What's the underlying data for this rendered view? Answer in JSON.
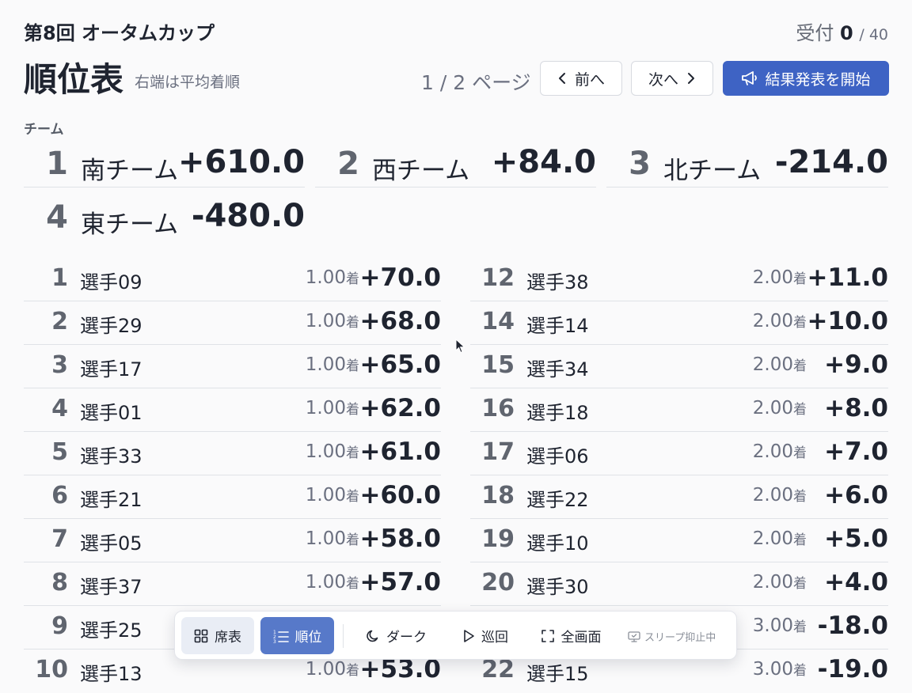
{
  "header": {
    "event_title": "第8回 オータムカップ",
    "reception_label": "受付",
    "reception_count": "0",
    "reception_total": "/ 40"
  },
  "title": "順位表",
  "subtitle": "右端は平均着順",
  "pager": {
    "indicator": "1 / 2 ページ",
    "prev_label": "前へ",
    "next_label": "次へ",
    "announce_label": "結果発表を開始"
  },
  "teams_label": "チーム",
  "teams": [
    {
      "rank": "1",
      "name": "南チーム",
      "score": "+610.0"
    },
    {
      "rank": "2",
      "name": "西チーム",
      "score": "+84.0"
    },
    {
      "rank": "3",
      "name": "北チーム",
      "score": "-214.0"
    },
    {
      "rank": "4",
      "name": "東チーム",
      "score": "-480.0"
    }
  ],
  "avg_unit": "着",
  "players_left": [
    {
      "rank": "1",
      "name": "選手09",
      "avg": "1.00",
      "score": "+70.0"
    },
    {
      "rank": "2",
      "name": "選手29",
      "avg": "1.00",
      "score": "+68.0"
    },
    {
      "rank": "3",
      "name": "選手17",
      "avg": "1.00",
      "score": "+65.0"
    },
    {
      "rank": "4",
      "name": "選手01",
      "avg": "1.00",
      "score": "+62.0"
    },
    {
      "rank": "5",
      "name": "選手33",
      "avg": "1.00",
      "score": "+61.0"
    },
    {
      "rank": "6",
      "name": "選手21",
      "avg": "1.00",
      "score": "+60.0"
    },
    {
      "rank": "7",
      "name": "選手05",
      "avg": "1.00",
      "score": "+58.0"
    },
    {
      "rank": "8",
      "name": "選手37",
      "avg": "1.00",
      "score": "+57.0"
    },
    {
      "rank": "9",
      "name": "選手25",
      "avg": "",
      "score": ""
    },
    {
      "rank": "10",
      "name": "選手13",
      "avg": "1.00",
      "score": "+53.0"
    }
  ],
  "players_right": [
    {
      "rank": "12",
      "name": "選手38",
      "avg": "2.00",
      "score": "+11.0"
    },
    {
      "rank": "14",
      "name": "選手14",
      "avg": "2.00",
      "score": "+10.0"
    },
    {
      "rank": "15",
      "name": "選手34",
      "avg": "2.00",
      "score": "+9.0"
    },
    {
      "rank": "16",
      "name": "選手18",
      "avg": "2.00",
      "score": "+8.0"
    },
    {
      "rank": "17",
      "name": "選手06",
      "avg": "2.00",
      "score": "+7.0"
    },
    {
      "rank": "18",
      "name": "選手22",
      "avg": "2.00",
      "score": "+6.0"
    },
    {
      "rank": "19",
      "name": "選手10",
      "avg": "2.00",
      "score": "+5.0"
    },
    {
      "rank": "20",
      "name": "選手30",
      "avg": "2.00",
      "score": "+4.0"
    },
    {
      "rank": "",
      "name": "",
      "avg": "3.00",
      "score": "-18.0"
    },
    {
      "rank": "22",
      "name": "選手15",
      "avg": "3.00",
      "score": "-19.0"
    }
  ],
  "toolbar": {
    "seat_label": "席表",
    "ranking_label": "順位",
    "dark_label": "ダーク",
    "tour_label": "巡回",
    "fullscreen_label": "全画面",
    "sleep_label": "スリープ抑止中"
  },
  "colors": {
    "primary": "#3e63c4",
    "active_tab": "#5779c9",
    "text": "#1f2430",
    "muted": "#6b7080",
    "background": "#fafafb"
  }
}
